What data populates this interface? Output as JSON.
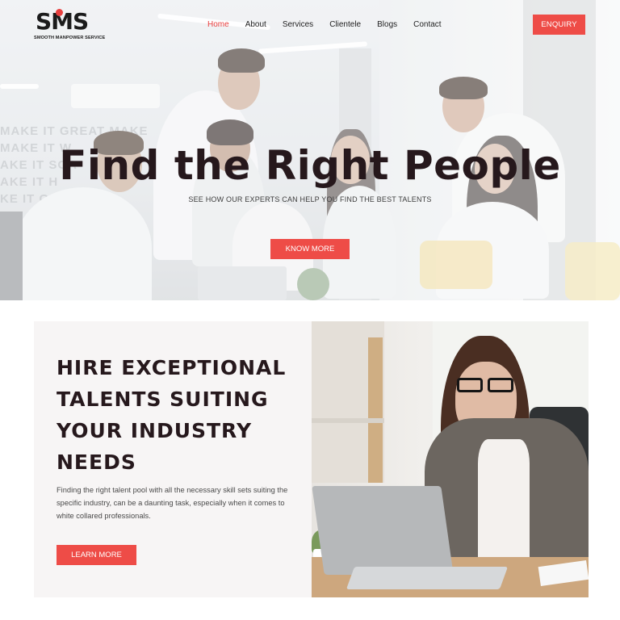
{
  "brand": {
    "logo_text": "SMS",
    "tagline": "SMOOTH MANPOWER SERVICE"
  },
  "nav": {
    "items": [
      {
        "label": "Home",
        "active": true
      },
      {
        "label": "About",
        "active": false
      },
      {
        "label": "Services",
        "active": false
      },
      {
        "label": "Clientele",
        "active": false
      },
      {
        "label": "Blogs",
        "active": false
      },
      {
        "label": "Contact",
        "active": false
      }
    ],
    "enquiry_label": "ENQUIRY"
  },
  "hero": {
    "background_wall_text": "MAKE IT GREAT MAKE\nMAKE IT W\nAKE IT SOA\nAKE IT H\nKE IT GR",
    "title": "Find the Right People",
    "subtitle": "SEE HOW OUR EXPERTS CAN HELP YOU FIND THE BEST TALENTS",
    "cta_label": "KNOW MORE"
  },
  "hire_section": {
    "title": "HIRE EXCEPTIONAL TALENTS SUITING YOUR INDUSTRY NEEDS",
    "description": "Finding the right talent pool with all the necessary skill sets suiting the specific industry, can be a daunting task, especially when it comes to white collared professionals.",
    "cta_label": "LEARN MORE"
  },
  "colors": {
    "accent": "#ee4c47",
    "heading": "#26181c",
    "card_bg": "#f7f5f5"
  }
}
